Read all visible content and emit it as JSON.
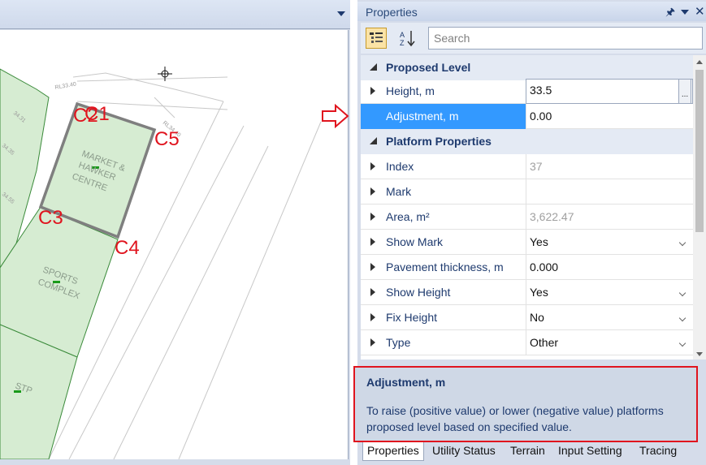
{
  "panel": {
    "title": "Properties",
    "search_placeholder": "Search",
    "icons": {
      "pin": "pin-icon",
      "dropdown": "chevron-down-icon",
      "close": "close-icon"
    }
  },
  "grid": {
    "categories": [
      "Proposed Level",
      "Platform Properties"
    ],
    "rows": [
      {
        "name": "Height, m",
        "value": "33.5"
      },
      {
        "name": "Adjustment, m",
        "value": "0.00"
      },
      {
        "name": "Index",
        "value": "37"
      },
      {
        "name": "Mark",
        "value": ""
      },
      {
        "name": "Area, m²",
        "value": "3,622.47"
      },
      {
        "name": "Show Mark",
        "value": "Yes"
      },
      {
        "name": "Pavement thickness, m",
        "value": "0.000"
      },
      {
        "name": "Show Height",
        "value": "Yes"
      },
      {
        "name": "Fix Height",
        "value": "No"
      },
      {
        "name": "Type",
        "value": "Other"
      }
    ],
    "ellipsis": "..."
  },
  "description": {
    "title": "Adjustment, m",
    "text": "To raise (positive value) or lower (negative value) platforms proposed level based on specified value."
  },
  "tabs": [
    "Properties",
    "Utility Status",
    "Terrain",
    "Input Setting",
    "Tracing"
  ],
  "drawing": {
    "point_labels": [
      "C2",
      "C1",
      "C5",
      "C3",
      "C4"
    ],
    "building_labels": {
      "market": [
        "MARKET &",
        "HAWKER",
        "CENTRE"
      ],
      "sports": [
        "SPORTS",
        "COMPLEX"
      ],
      "stp": "STP"
    },
    "level_labels": [
      "RL33.40",
      "RL34.40",
      "34.35",
      "34.55",
      "34.31"
    ]
  },
  "colors": {
    "accent_selection": "#3399ff",
    "highlight_border": "#e0141e",
    "land_parcel": "#d6ecd2",
    "selected_outline": "#7f7f7f"
  }
}
